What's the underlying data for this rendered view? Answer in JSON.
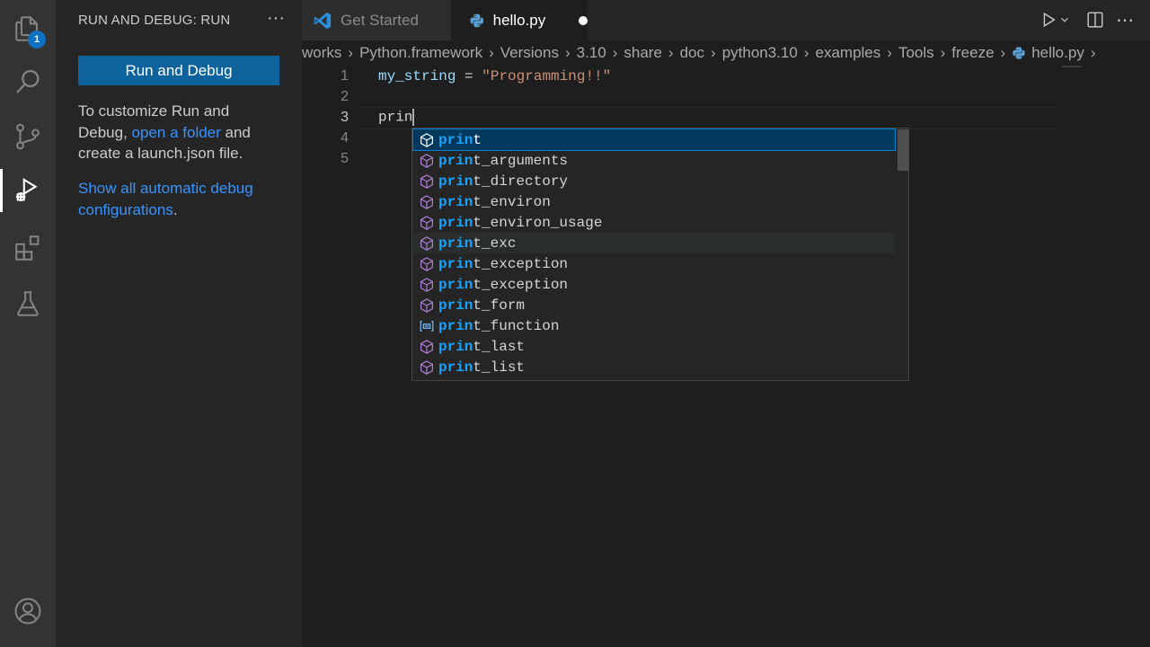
{
  "activitybar": {
    "explorer_badge": "1",
    "items": [
      "explorer-icon",
      "search-icon",
      "source-control-icon",
      "run-and-debug-icon",
      "extensions-icon",
      "testing-icon"
    ],
    "bottom": [
      "accounts-icon"
    ]
  },
  "sidebar": {
    "title": "RUN AND DEBUG: RUN",
    "more_label": "···",
    "run_button": "Run and Debug",
    "text_part1": "To customize Run and Debug, ",
    "open_folder_link": "open a folder",
    "text_part2": " and create a launch.json file.",
    "show_configs_link": "Show all automatic debug configurations",
    "show_configs_end": "."
  },
  "tabs": [
    {
      "label": "Get Started",
      "icon": "vscode-logo-icon",
      "active": false
    },
    {
      "label": "hello.py",
      "icon": "python-icon",
      "active": true,
      "dirty": true
    }
  ],
  "breadcrumb": [
    "works",
    "Python.framework",
    "Versions",
    "3.10",
    "share",
    "doc",
    "python3.10",
    "examples",
    "Tools",
    "freeze",
    "hello.py"
  ],
  "editor": {
    "lines": [
      {
        "number": "1",
        "var": "my_string",
        "op": " = ",
        "str": "\"Programming!!\""
      },
      {
        "number": "2",
        "text": ""
      },
      {
        "number": "3",
        "text": "prin"
      },
      {
        "number": "4",
        "text": ""
      },
      {
        "number": "5",
        "text": ""
      }
    ]
  },
  "suggest": {
    "prefix": "prin",
    "items": [
      {
        "rest": "t",
        "icon": "module-icon"
      },
      {
        "rest": "t_arguments",
        "icon": "module-icon"
      },
      {
        "rest": "t_directory",
        "icon": "module-icon"
      },
      {
        "rest": "t_environ",
        "icon": "module-icon"
      },
      {
        "rest": "t_environ_usage",
        "icon": "module-icon"
      },
      {
        "rest": "t_exc",
        "icon": "module-icon"
      },
      {
        "rest": "t_exception",
        "icon": "module-icon"
      },
      {
        "rest": "t_exception",
        "icon": "module-icon"
      },
      {
        "rest": "t_form",
        "icon": "module-icon"
      },
      {
        "rest": "t_function",
        "icon": "variable-icon"
      },
      {
        "rest": "t_last",
        "icon": "module-icon"
      },
      {
        "rest": "t_list",
        "icon": "module-icon"
      }
    ],
    "selected_index": 0,
    "hover_index": 5
  },
  "colors": {
    "accent": "#0e639c",
    "link": "#3794ff",
    "match": "#18a3ff",
    "module_icon": "#b180d7"
  }
}
